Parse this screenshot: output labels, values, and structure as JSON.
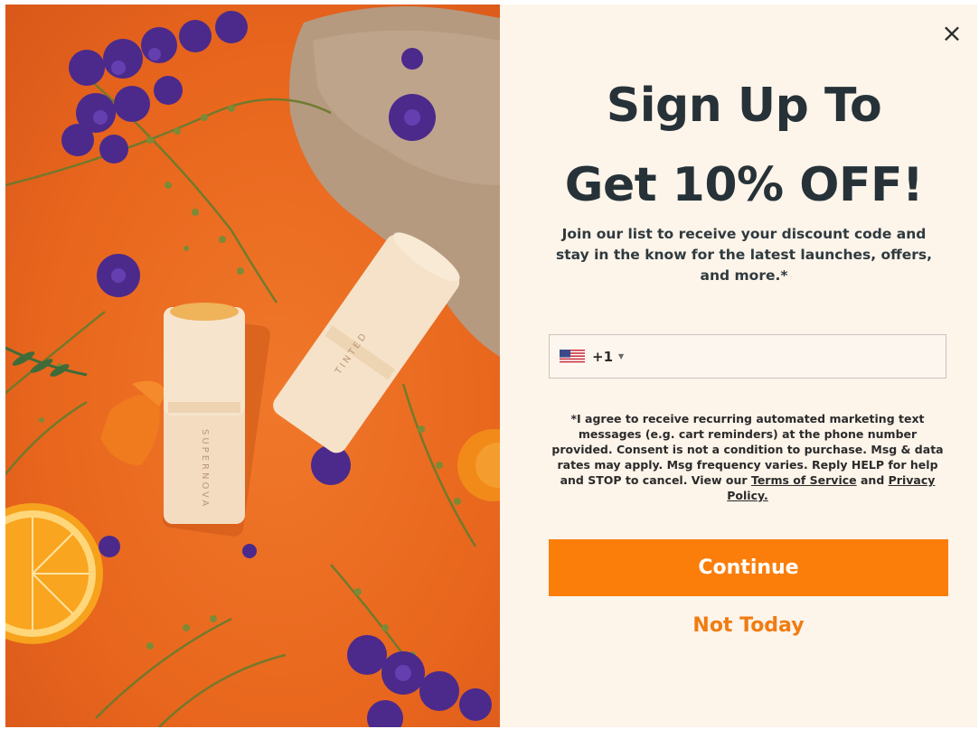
{
  "popup": {
    "close_icon": "×",
    "headline_line1": "Sign Up To",
    "headline_line2": "Get 10% OFF!",
    "subtext": "Join our list to receive your discount code and stay in the know for the latest launches, offers, and more.*",
    "phone": {
      "country_flag": "us-flag-icon",
      "dial_code": "+1",
      "caret": "▼",
      "value": ""
    },
    "consent_text": "*I agree to receive recurring automated marketing text messages (e.g. cart reminders) at the phone number provided. Consent is not a condition to purchase. Msg & data rates may apply. Msg frequency varies. Reply HELP for help and STOP to cancel. View our",
    "terms_link": "Terms of Service",
    "consent_and": "and",
    "privacy_link": "Privacy Policy.",
    "continue_label": "Continue",
    "not_today_label": "Not Today"
  },
  "image": {
    "stick_right_label": "TINTED",
    "stick_left_label": "SUPERNOVA"
  },
  "colors": {
    "accent": "#fb7e0a",
    "panel_background": "#fdf4ea",
    "headline": "#263238",
    "image_background": "#e8661d"
  }
}
